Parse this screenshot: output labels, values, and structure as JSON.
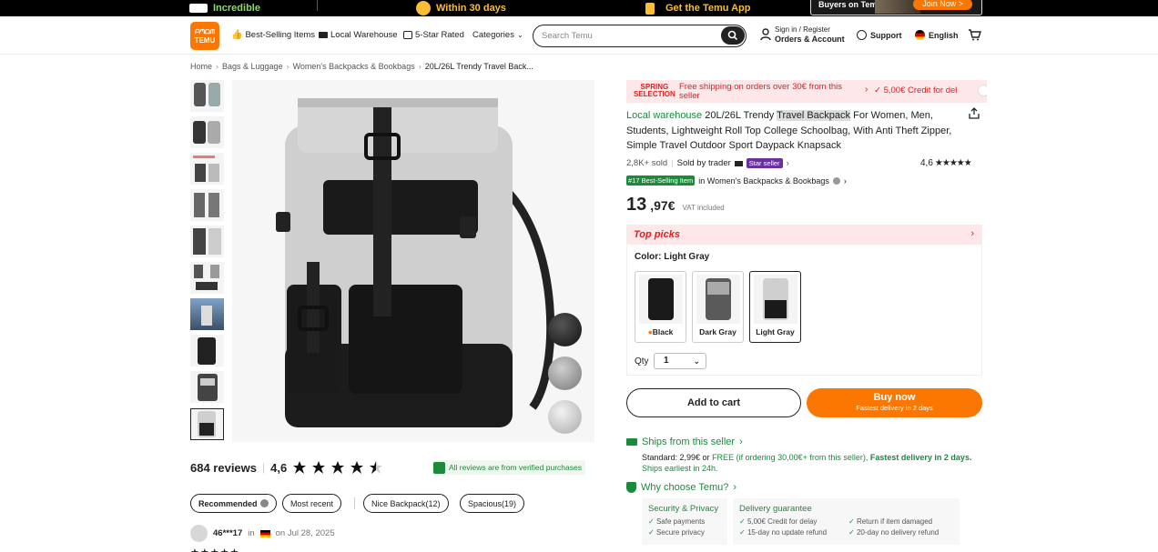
{
  "promo": {
    "item1": "Incredible",
    "item2": "Within 30 days",
    "item3": "Get the Temu App",
    "buyers": "Buyers on Temu",
    "join": "Join Now >"
  },
  "header": {
    "logo_top": "ᗩᘉᗝᗰ",
    "logo_bottom": "TEMU",
    "nav": [
      "Best-Selling Items",
      "Local Warehouse",
      "5-Star Rated",
      "Categories"
    ],
    "search_placeholder": "Search Temu",
    "sign_in": "Sign in / Register",
    "orders": "Orders & Account",
    "support": "Support",
    "language": "English"
  },
  "breadcrumb": [
    "Home",
    "Bags & Luggage",
    "Women's Backpacks & Bookbags",
    "20L/26L Trendy Travel Back..."
  ],
  "reviews": {
    "count": "684 reviews",
    "rating": "4,6",
    "verified": "All reviews are from verified purchases",
    "filters": [
      "Recommended",
      "Most recent",
      "Nice Backpack(12)",
      "Spacious(19)"
    ],
    "first_reviewer": "46***17",
    "in": "in",
    "date": "on Jul 28, 2025"
  },
  "spring": {
    "logo_line1": "SPRING",
    "logo_line2": "SELECTION",
    "shipping": "Free shipping on orders over 30€ from this seller",
    "credit": "✓ 5,00€ Credit for del"
  },
  "product": {
    "local_warehouse": "Local warehouse",
    "title_a": "20L/26L Trendy ",
    "title_hl": "Travel Backpack",
    "title_b": " For Women, Men, Students, Lightweight Roll Top College Schoolbag, With Anti Theft Zipper, Simple Travel Outdoor Sport Daypack Knapsack",
    "sold": "2,8K+ sold",
    "sold_by": "Sold by trader",
    "star_seller": "Star seller",
    "rating": "4,6",
    "rank_tag": "#17 Best-Selling Item",
    "rank_text": "in Women's Backpacks & Bookbags",
    "price_int": "13",
    "price_dec": ",97€",
    "vat": "VAT included"
  },
  "picks": {
    "title": "Top picks",
    "color_label": "Color: Light Gray",
    "options": [
      "Black",
      "Dark Gray",
      "Light Gray"
    ],
    "qty_label": "Qty",
    "qty_value": "1"
  },
  "actions": {
    "add_to_cart": "Add to cart",
    "buy_now": "Buy now",
    "buy_sub": "Fastest delivery in 2 days"
  },
  "shipping": {
    "ships_from": "Ships from this seller",
    "standard": "Standard: 2,99€ or ",
    "free": "FREE (if ordering 30,00€+ from this seller),",
    "fastest": " Fastest delivery in 2 days.",
    "earliest": " Ships earliest in 24h."
  },
  "why": {
    "title": "Why choose Temu?",
    "security_title": "Security & Privacy",
    "security_items": [
      "Safe payments",
      "Secure privacy"
    ],
    "delivery_title": "Delivery guarantee",
    "delivery_items": [
      "5,00€ Credit for delay",
      "15-day no update refund",
      "Return if item damaged",
      "20-day no delivery refund"
    ]
  },
  "colors": {
    "accent": "#fb7701",
    "green": "#1b8a3a",
    "red": "#e02020"
  }
}
